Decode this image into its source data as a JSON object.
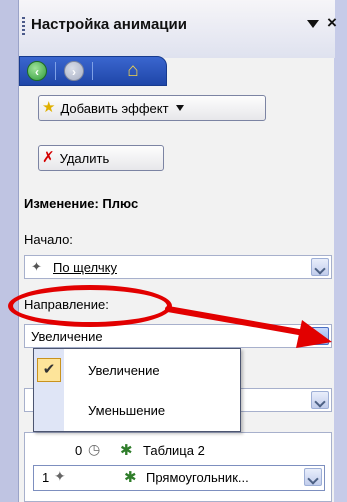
{
  "title_bar": {
    "title": "Настройка анимации",
    "menu_icon": "triangle-down-icon",
    "close_glyph": "×"
  },
  "nav": {
    "back_icon": "back-arrow-icon",
    "forward_icon": "forward-arrow-icon",
    "home_icon": "home-icon"
  },
  "toolbar": {
    "add_effect_label": "Добавить эффект",
    "remove_label": "Удалить"
  },
  "effect": {
    "section_title": "Изменение: Плюс",
    "start_label": "Начало:",
    "start_value": "По щелчку",
    "direction_label": "Направление:",
    "direction_value": "Увеличение"
  },
  "direction_dropdown": {
    "options": [
      "Увеличение",
      "Уменьшение"
    ],
    "selected_index": 0
  },
  "animation_list": {
    "items": [
      {
        "number": "0",
        "trigger_icon": "clock-icon",
        "effect_icon": "star-icon",
        "name": "Таблица 2"
      },
      {
        "number": "1",
        "trigger_icon": "mouse-icon",
        "effect_icon": "star-icon",
        "name": "Прямоугольник..."
      }
    ]
  },
  "annotation_colors": {
    "highlight": "#e20000"
  }
}
